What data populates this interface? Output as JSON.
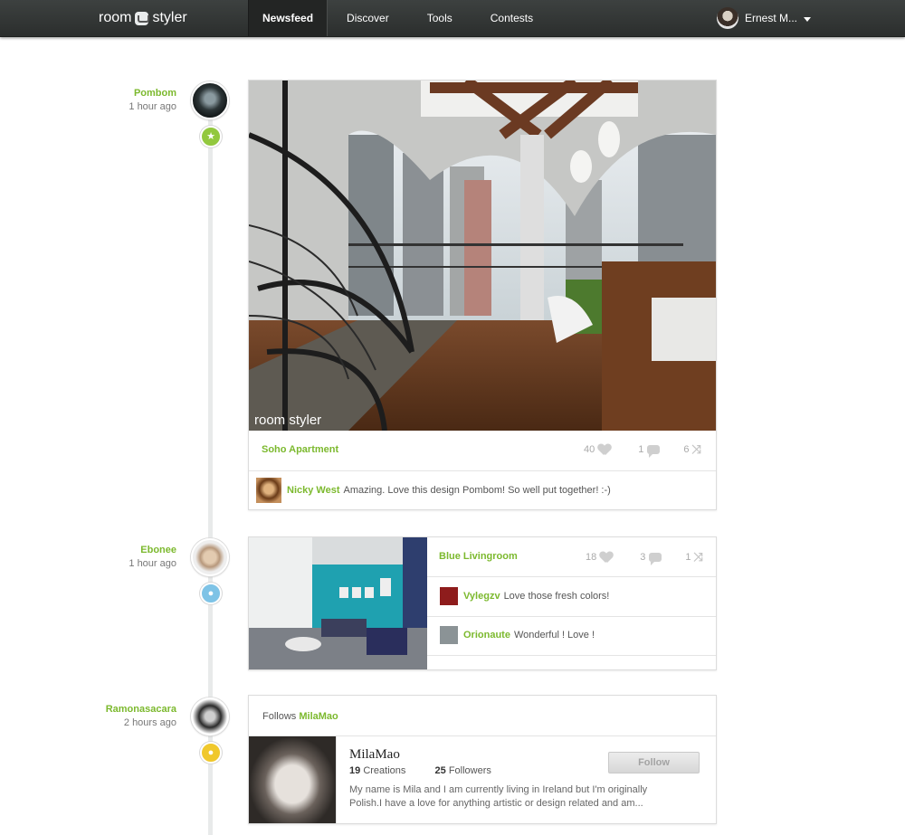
{
  "brand": {
    "word1": "room",
    "word2": "styler"
  },
  "nav": [
    {
      "label": "Newsfeed",
      "active": true
    },
    {
      "label": "Discover"
    },
    {
      "label": "Tools"
    },
    {
      "label": "Contests"
    }
  ],
  "user": {
    "name": "Ernest M..."
  },
  "colors": {
    "accent": "#7cb92e",
    "badge_green": "#92c83e",
    "badge_blue": "#7ec3e6",
    "badge_yellow": "#f0c82c"
  },
  "feed": [
    {
      "author": "Pombom",
      "time": "1 hour ago",
      "badge_icon": "star-icon",
      "design_title": "Soho Apartment",
      "watermark": "room styler",
      "likes": "40",
      "comments": "1",
      "remixes": "6",
      "comment_list": [
        {
          "name": "Nicky West",
          "text": "Amazing. Love this design Pombom! So well put together! :-)"
        }
      ]
    },
    {
      "author": "Ebonee",
      "time": "1 hour ago",
      "badge_icon": "comment-icon",
      "design_title": "Blue Livingroom",
      "likes": "18",
      "comments": "3",
      "remixes": "1",
      "comment_list": [
        {
          "name": "Vylegzv",
          "text": "Love those fresh colors!"
        },
        {
          "name": "Orionaute",
          "text": "Wonderful ! Love !"
        }
      ]
    },
    {
      "author": "Ramonasacara",
      "time": "2 hours ago",
      "badge_icon": "user-icon",
      "follows_prefix": "Follows",
      "follows_name": "MilaMao",
      "profile": {
        "name": "MilaMao",
        "creations_count": "19",
        "creations_label": "Creations",
        "followers_count": "25",
        "followers_label": "Followers",
        "bio_line1": "My name is Mila and I am currently living in Ireland but I'm originally",
        "bio_line2": "Polish.I have a love for anything artistic or design related and am...",
        "follow_label": "Follow"
      }
    }
  ]
}
